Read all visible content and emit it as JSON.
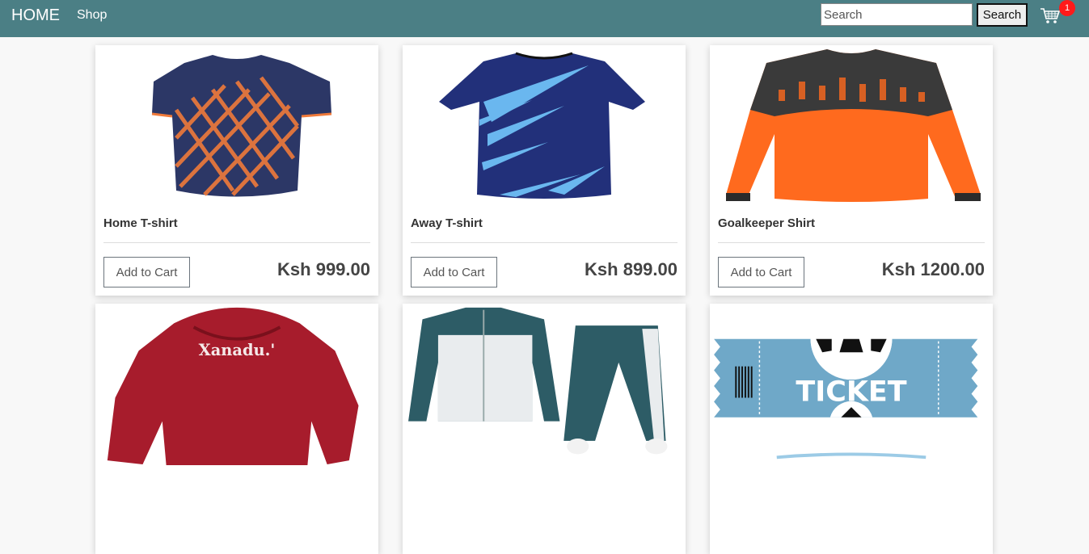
{
  "navbar": {
    "brand": "HOME",
    "shop_link": "Shop",
    "search_placeholder": "Search",
    "search_button": "Search",
    "cart_count": "1",
    "cart_icon": "shopping-cart-icon",
    "brand_color": "#4b7f85",
    "badge_color": "#ff1a1a"
  },
  "products": [
    {
      "name": "Home T-shirt",
      "price": "Ksh 999.00",
      "add_label": "Add to Cart",
      "image": "home-tshirt-image"
    },
    {
      "name": "Away T-shirt",
      "price": "Ksh 899.00",
      "add_label": "Add to Cart",
      "image": "away-tshirt-image"
    },
    {
      "name": "Goalkeeper Shirt",
      "price": "Ksh 1200.00",
      "add_label": "Add to Cart",
      "image": "goalkeeper-shirt-image"
    },
    {
      "name": "",
      "price": "",
      "add_label": "",
      "image": "hoodie-image",
      "image_text": "Xanadu.'"
    },
    {
      "name": "",
      "price": "",
      "add_label": "",
      "image": "tracksuit-image"
    },
    {
      "name": "",
      "price": "",
      "add_label": "",
      "image": "ticket-image",
      "image_text": "TICKET"
    }
  ]
}
